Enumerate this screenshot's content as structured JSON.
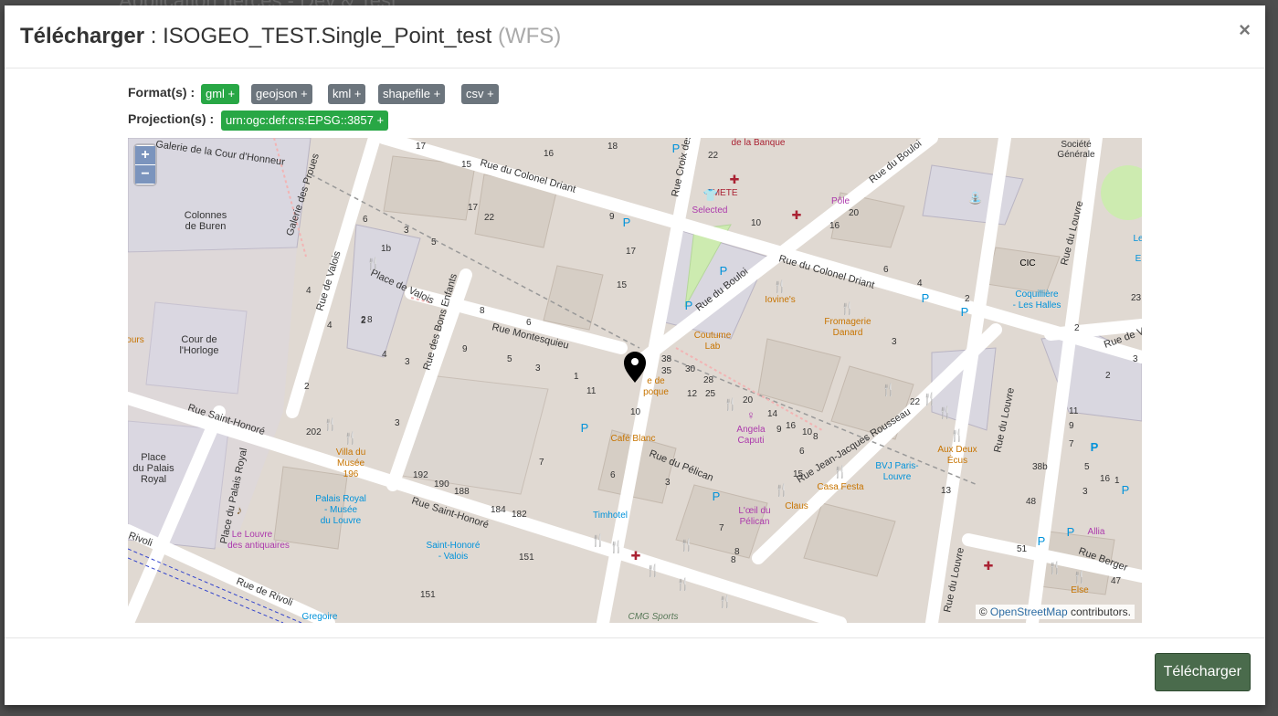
{
  "backdrop": {
    "text": "Application tierces - Dev & Test"
  },
  "modal": {
    "title_action": "Télécharger",
    "title_sep": " : ",
    "title_name": "ISOGEO_TEST.Single_Point_test",
    "title_service": "(WFS)",
    "close_label": "×"
  },
  "formats": {
    "label": "Format(s) :",
    "items": [
      {
        "label": "gml +",
        "selected": true
      },
      {
        "label": "geojson +",
        "selected": false
      },
      {
        "label": "kml +",
        "selected": false
      },
      {
        "label": "shapefile +",
        "selected": false
      },
      {
        "label": "csv +",
        "selected": false
      }
    ]
  },
  "projections": {
    "label": "Projection(s) :",
    "items": [
      {
        "label": "urn:ogc:def:crs:EPSG::3857 +",
        "selected": true
      }
    ]
  },
  "map": {
    "zoom_in": "+",
    "zoom_out": "−",
    "attribution_prefix": "©",
    "attribution_link": "OpenStreetMap",
    "attribution_suffix": " contributors.",
    "streets": {
      "rue_du_colonel_driant_1": "Rue du Colonel Driant",
      "rue_du_colonel_driant_2": "Rue du Colonel Driant",
      "rue_saint_honore_1": "Rue Saint-Honoré",
      "rue_saint_honore_2": "Rue Saint-Honoré",
      "rue_de_valois": "Rue de Valois",
      "place_de_valois": "Place de Valois",
      "rue_des_bons_enfants": "Rue des Bons Enfants",
      "rue_montesquieu": "Rue Montesquieu",
      "rue_du_bouloi_1": "Rue du Bouloi",
      "rue_du_bouloi_2": "Rue du Bouloi",
      "rue_croix": "Rue Croix des",
      "rue_du_pelican": "Rue du Pélican",
      "rue_jean_jacques_rousseau": "Rue Jean-Jacques Rousseau",
      "rue_du_louvre_1": "Rue du Louvre",
      "rue_du_louvre_2": "Rue du Louvre",
      "rue_du_louvre_3": "Rue du Louvre",
      "rue_de_rivoli_1": "Rue de Rivoli",
      "rue_de_rivoli_2": "Rivoli",
      "place_du_palais_royal_street": "Place du Palais Royal",
      "galerie_proues": "Galerie des Proues",
      "galerie_cour": "Galerie de la Cour d'Honneur",
      "rue_berger": "Rue Berger",
      "rue_de_v": "Rue de V"
    },
    "places": {
      "colonnes_1": "Colonnes",
      "colonnes_2": "de Buren",
      "cour_1": "Cour de",
      "cour_2": "l'Horloge",
      "place_palais_1": "Place",
      "place_palais_2": "du Palais",
      "place_palais_3": "Royal",
      "ours": "ours",
      "societe_1": "Société",
      "societe_2": "Générale",
      "banque": "de la Banque"
    },
    "pois": {
      "cmete": "CMETE",
      "selected": "Selected",
      "pole": "Pôle",
      "cic": "CIC",
      "iovine": "Iovine's",
      "fromagerie_1": "Fromagerie",
      "fromagerie_2": "Danard",
      "coutume_1": "Coutume",
      "coutume_2": "Lab",
      "epoque_1": "e de",
      "epoque_2": "poque",
      "cafe_blanc": "Café Blanc",
      "angela_1": "Angela",
      "angela_2": "Caputi",
      "aux_deux_1": "Aux Deux",
      "aux_deux_2": "Écus",
      "bvj_1": "BVJ Paris-",
      "bvj_2": "Louvre",
      "casa_festa": "Casa Festa",
      "claus": "Claus",
      "oeil_1": "L'œil du",
      "oeil_2": "Pélican",
      "timhotel": "Timhotel",
      "villa_1": "Villa du",
      "villa_2": "Musée",
      "villa_3": "196",
      "palais_musee_1": "Palais Royal",
      "palais_musee_2": "- Musée",
      "palais_musee_3": "du Louvre",
      "louvre_antiq_1": "Le Louvre",
      "louvre_antiq_2": "des antiquaires",
      "st_honore_valois_1": "Saint-Honoré",
      "st_honore_valois_2": "- Valois",
      "gregoire": "Gregoire",
      "coquilliere_1": "Coquillière",
      "coquilliere_2": "- Les Halles",
      "allia": "Allia",
      "else": "Else",
      "cmg_sports": "CMG Sports",
      "le": "Le",
      "e": "E"
    },
    "numbers": [
      "17",
      "16",
      "18",
      "15",
      "6",
      "22",
      "9",
      "17",
      "22",
      "17",
      "15",
      "4",
      "2",
      "1",
      "5",
      "3",
      "8",
      "6",
      "5",
      "3",
      "9",
      "5",
      "3",
      "1",
      "11",
      "7",
      "2",
      "4",
      "3",
      "2",
      "1b",
      "3",
      "4",
      "8",
      "6",
      "2",
      "202",
      "192",
      "190",
      "188",
      "184",
      "182",
      "151",
      "151",
      "38",
      "35",
      "30",
      "28",
      "25",
      "12",
      "20",
      "14",
      "16",
      "10",
      "8",
      "6",
      "9",
      "10",
      "8",
      "4",
      "2",
      "22",
      "20",
      "16",
      "6",
      "4",
      "2",
      "3",
      "2",
      "1",
      "11",
      "9",
      "7",
      "5",
      "38b",
      "48",
      "3",
      "1",
      "51",
      "47",
      "47",
      "3",
      "9",
      "7",
      "10",
      "6",
      "8",
      "2",
      "1",
      "13",
      "16",
      "23",
      "3"
    ],
    "marker_label": "point"
  },
  "footer": {
    "download_label": "Télécharger"
  }
}
